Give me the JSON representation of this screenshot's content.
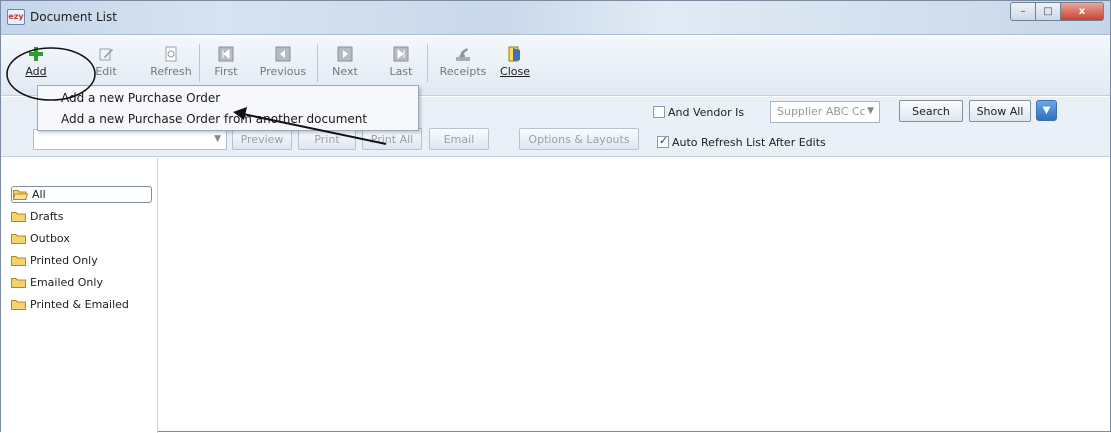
{
  "window": {
    "app_logo": "ezy",
    "title": "Document List",
    "controls": {
      "minimize": "–",
      "maximize": "□",
      "close": "x"
    }
  },
  "toolbar": {
    "add": "Add",
    "edit": "Edit",
    "refresh": "Refresh",
    "first": "First",
    "previous": "Previous",
    "next": "Next",
    "last": "Last",
    "receipts": "Receipts",
    "close": "Close"
  },
  "add_menu": {
    "items": [
      "Add a new Purchase Order",
      "Add a new Purchase Order from another document"
    ]
  },
  "filter": {
    "vendor_checkbox_label": "And Vendor Is",
    "vendor_checked": false,
    "vendor_value": "Supplier ABC Cc",
    "search_label": "Search",
    "show_all_label": "Show All"
  },
  "print_row": {
    "preview": "Preview",
    "print": "Print",
    "print_all": "Print All",
    "email": "Email",
    "options_layouts": "Options & Layouts",
    "auto_refresh_label": "Auto Refresh List After Edits",
    "auto_refresh_checked": true
  },
  "folders": [
    {
      "label": "All",
      "selected": true
    },
    {
      "label": "Drafts",
      "selected": false
    },
    {
      "label": "Outbox",
      "selected": false
    },
    {
      "label": "Printed Only",
      "selected": false
    },
    {
      "label": "Emailed Only",
      "selected": false
    },
    {
      "label": "Printed & Emailed",
      "selected": false
    }
  ],
  "colors": {
    "folder_fill": "#f5d36b",
    "add_icon": "#2f9e2f",
    "close_icon": "#3f6fb5",
    "accent_blue": "#2f6fbf"
  },
  "icons": {
    "add": "green-plus-icon",
    "edit": "pencil-icon",
    "refresh": "refresh-doc-icon",
    "first": "first-record-icon",
    "previous": "previous-record-icon",
    "next": "next-record-icon",
    "last": "last-record-icon",
    "receipts": "receipt-stamp-icon",
    "close": "door-exit-icon",
    "folder": "folder-icon"
  }
}
